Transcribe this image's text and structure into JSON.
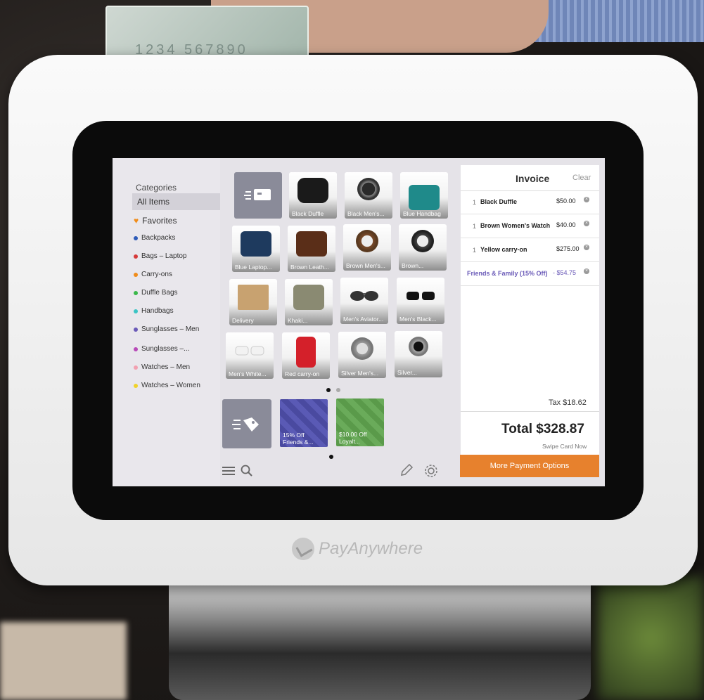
{
  "card": {
    "digits": "1234  567890"
  },
  "brand": {
    "name": "PayAnywhere"
  },
  "sidebar": {
    "title": "Categories",
    "all_items": "All Items",
    "favorites": "Favorites",
    "items": [
      {
        "label": "Backpacks",
        "color": "#2e5bb8"
      },
      {
        "label": "Bags – Laptop",
        "color": "#d63a3a"
      },
      {
        "label": "Carry-ons",
        "color": "#f08c1a"
      },
      {
        "label": "Duffle Bags",
        "color": "#3ab84a"
      },
      {
        "label": "Handbags",
        "color": "#3ac4c4"
      },
      {
        "label": "Sunglasses – Men",
        "color": "#6a5ab8"
      },
      {
        "label": "Sunglasses –...",
        "color": "#b84ab8"
      },
      {
        "label": "Watches – Men",
        "color": "#f2a0b0"
      },
      {
        "label": "Watches – Women",
        "color": "#f0d22a"
      }
    ]
  },
  "products": {
    "row1": [
      "Black Duffle",
      "Black Men's...",
      "Blue Handbag"
    ],
    "row2": [
      "Blue Laptop...",
      "Brown Leath...",
      "Brown Men's...",
      "Brown..."
    ],
    "row3": [
      "Delivery",
      "Khaki...",
      "Men's Aviator...",
      "Men's Black..."
    ],
    "row4": [
      "Men's White...",
      "Red carry-on",
      "Silver Men's...",
      "Silver..."
    ]
  },
  "discounts": [
    {
      "line1": "15% Off",
      "line2": "Friends &...",
      "color": "#4a4aa0"
    },
    {
      "line1": "$10.00 Off",
      "line2": "Loyalt...",
      "color": "#5a9a4a"
    }
  ],
  "invoice": {
    "title": "Invoice",
    "clear": "Clear",
    "lines": [
      {
        "qty": "1",
        "name": "Black Duffle",
        "price": "$50.00"
      },
      {
        "qty": "1",
        "name": "Brown Women's Watch",
        "price": "$40.00"
      },
      {
        "qty": "1",
        "name": "Yellow carry-on",
        "price": "$275.00"
      }
    ],
    "discount": {
      "name": "Friends & Family (15% Off)",
      "amount": "- $54.75",
      "color": "#6a5ab8"
    },
    "tax": "Tax $18.62",
    "total": "Total $328.87",
    "swipe": "Swipe Card Now",
    "more_payment": "More Payment Options"
  },
  "colors": {
    "accent_orange": "#e7812d",
    "tile_gray": "#8a8b99"
  }
}
